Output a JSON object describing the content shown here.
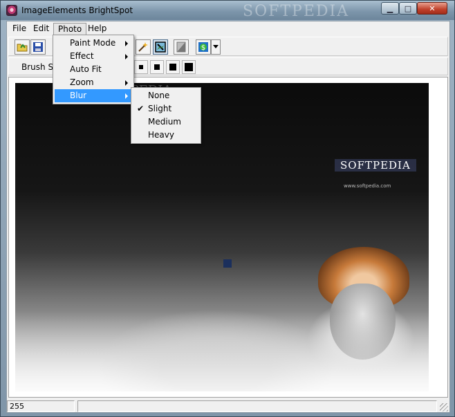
{
  "window": {
    "title": "ImageElements BrightSpot",
    "title_watermark": "SOFTPEDIA"
  },
  "menubar": {
    "items": [
      "File",
      "Edit",
      "Photo",
      "Help"
    ]
  },
  "photo_menu": {
    "items": [
      {
        "label": "Paint Mode",
        "submenu": true
      },
      {
        "label": "Effect",
        "submenu": true
      },
      {
        "label": "Auto Fit",
        "submenu": false
      },
      {
        "label": "Zoom",
        "submenu": true
      },
      {
        "label": "Blur",
        "submenu": true
      }
    ]
  },
  "blur_submenu": {
    "items": [
      {
        "label": "None",
        "checked": false
      },
      {
        "label": "Slight",
        "checked": true
      },
      {
        "label": "Medium",
        "checked": false
      },
      {
        "label": "Heavy",
        "checked": false
      }
    ]
  },
  "toolbar2": {
    "brush_label": "Brush Size"
  },
  "canvas": {
    "watermark": "SOFTPEDIA",
    "watermark2": "SOFTPEDIA",
    "url": "www.softpedia.com"
  },
  "statusbar": {
    "value": "255"
  },
  "colors": {
    "highlight": "#3399ff",
    "menu_bg": "#f0f0f0"
  },
  "icons": [
    "open-folder-icon",
    "save-icon",
    "magic-wand-icon",
    "select-image-icon",
    "page-icon",
    "dollar-icon",
    "dropdown-arrow-icon"
  ]
}
